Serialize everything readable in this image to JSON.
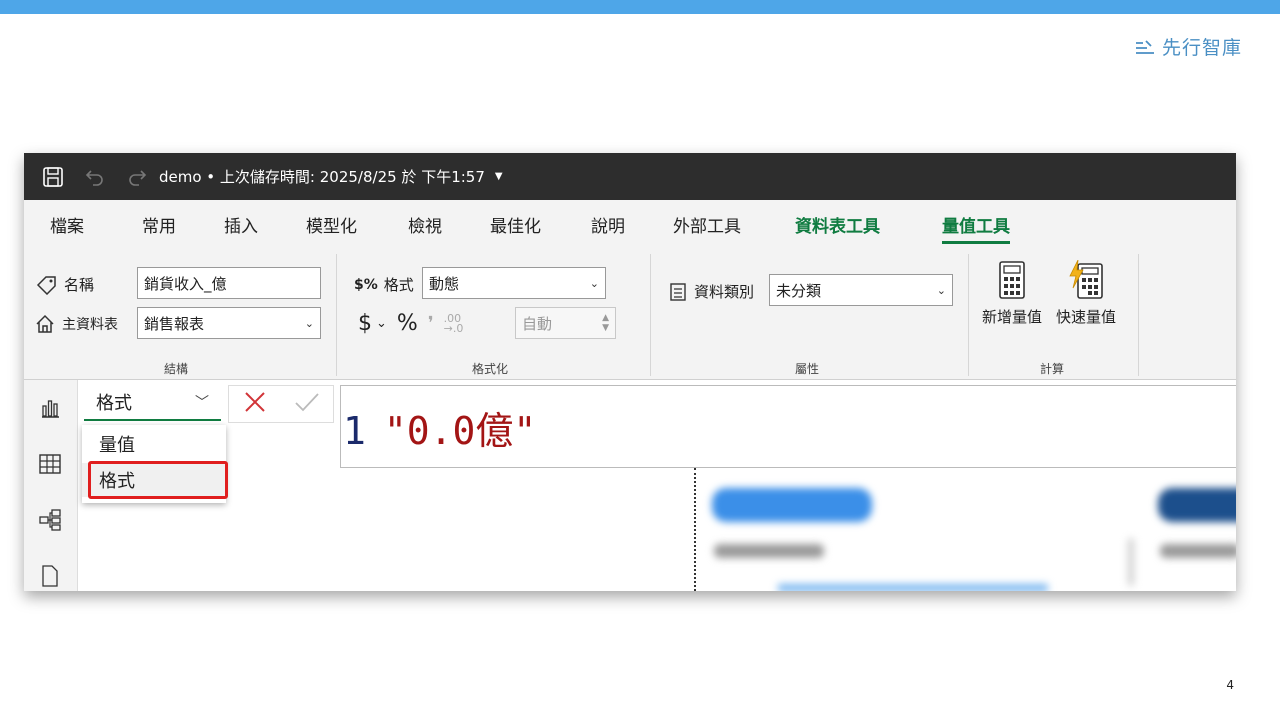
{
  "brand": {
    "name": "先行智庫",
    "icon": "brand-logo-icon"
  },
  "page_number": "4",
  "titlebar": {
    "title": "demo • 上次儲存時間: 2025/8/25 於 下午1:57",
    "icons": [
      "save-icon",
      "undo-icon",
      "redo-icon",
      "caret-down-icon"
    ]
  },
  "tabs": [
    "檔案",
    "常用",
    "插入",
    "模型化",
    "檢視",
    "最佳化",
    "說明",
    "外部工具",
    "資料表工具",
    "量值工具"
  ],
  "ribbon": {
    "structure": {
      "group_label": "結構",
      "name_label": "名稱",
      "name_value": "銷貨收入_億",
      "home_table_label": "主資料表",
      "home_table_value": "銷售報表"
    },
    "formatting": {
      "group_label": "格式化",
      "format_label": "格式",
      "format_value": "動態",
      "currency_symbol": "$",
      "percent_symbol": "%",
      "auto_value": "自動"
    },
    "properties": {
      "group_label": "屬性",
      "data_category_label": "資料類別",
      "data_category_value": "未分類"
    },
    "calculations": {
      "group_label": "計算",
      "new_measure_label": "新增量值",
      "quick_measure_label": "快速量值"
    }
  },
  "formula_bar": {
    "dropdown_value": "格式",
    "line_number": "1",
    "expression": "\"0.0億\""
  },
  "dropdown_menu": {
    "items": [
      "量值",
      "格式"
    ],
    "selected": "格式"
  },
  "colors": {
    "accent_green": "#107c41",
    "highlight_red": "#e01e1e",
    "top_bar_blue": "#4ea6e8"
  }
}
